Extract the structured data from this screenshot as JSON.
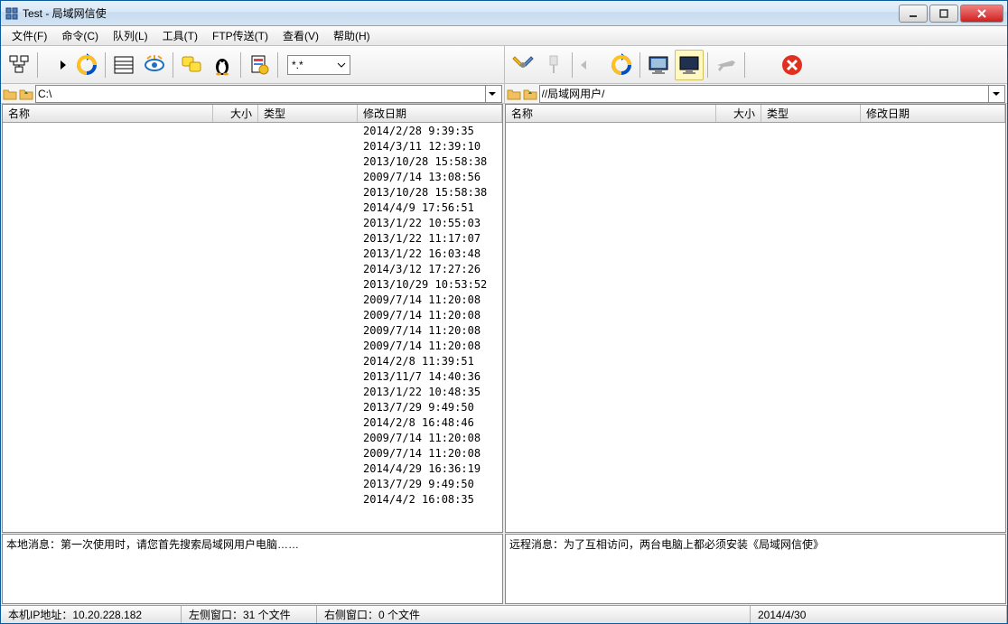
{
  "title": "Test - 局域网信使",
  "menu": [
    "文件(F)",
    "命令(C)",
    "队列(L)",
    "工具(T)",
    "FTP传送(T)",
    "查看(V)",
    "帮助(H)"
  ],
  "left_path": "C:\\",
  "right_path": "//局域网用户/",
  "filter": "*.*",
  "columns": {
    "name": "名称",
    "size": "大小",
    "type": "类型",
    "date": "修改日期"
  },
  "left_rows": [
    {
      "date": "2014/2/28 9:39:35"
    },
    {
      "date": "2014/3/11 12:39:10"
    },
    {
      "date": "2013/10/28 15:58:38"
    },
    {
      "date": "2009/7/14 13:08:56"
    },
    {
      "date": "2013/10/28 15:58:38"
    },
    {
      "date": "2014/4/9 17:56:51"
    },
    {
      "date": "2013/1/22 10:55:03"
    },
    {
      "date": "2013/1/22 11:17:07"
    },
    {
      "date": "2013/1/22 16:03:48"
    },
    {
      "date": "2014/3/12 17:27:26"
    },
    {
      "date": "2013/10/29 10:53:52"
    },
    {
      "date": "2009/7/14 11:20:08"
    },
    {
      "date": "2009/7/14 11:20:08"
    },
    {
      "date": "2009/7/14 11:20:08"
    },
    {
      "date": "2009/7/14 11:20:08"
    },
    {
      "date": "2014/2/8 11:39:51"
    },
    {
      "date": "2013/11/7 14:40:36"
    },
    {
      "date": "2013/1/22 10:48:35"
    },
    {
      "date": "2013/7/29 9:49:50"
    },
    {
      "date": "2014/2/8 16:48:46"
    },
    {
      "date": "2009/7/14 11:20:08"
    },
    {
      "date": "2009/7/14 11:20:08"
    },
    {
      "date": "2014/4/29 16:36:19"
    },
    {
      "date": "2013/7/29 9:49:50"
    },
    {
      "date": "2014/4/2 16:08:35"
    }
  ],
  "right_rows": [],
  "local_msg": "本地消息：第一次使用时，请您首先搜索局域网用户电脑……",
  "remote_msg": "远程消息：为了互相访问，两台电脑上都必须安装《局域网信使》",
  "status": {
    "ip": "本机IP地址：10.20.228.182",
    "left_window": "左侧窗口：31 个文件",
    "right_window": "右侧窗口：0 个文件",
    "date": "2014/4/30"
  }
}
